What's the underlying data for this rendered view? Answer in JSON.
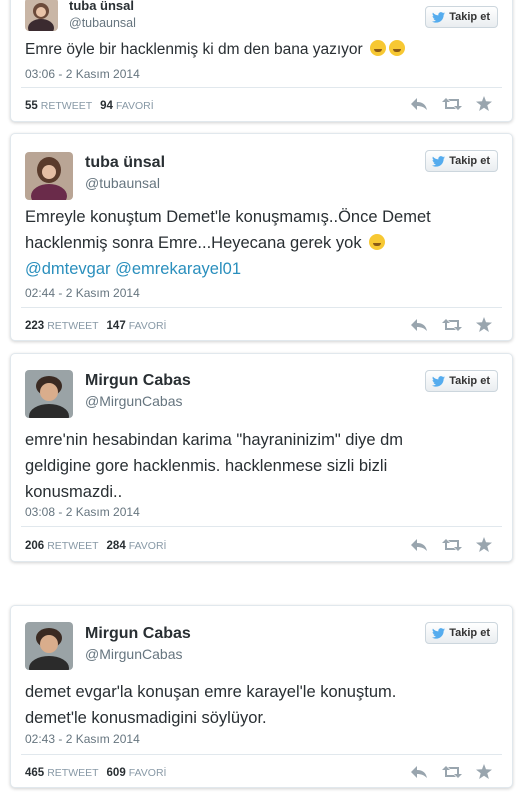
{
  "follow_label": "Takip et",
  "tweets": [
    {
      "name": "tuba ünsal",
      "handle": "@tubaunsal",
      "text": "Emre öyle bir hacklenmiş ki dm den bana yazıyor",
      "text_lines": [],
      "mentions": "",
      "date": "03:06 - 2 Kasım 2014",
      "retweets": "55",
      "retweet_label": "RETWEET",
      "favorites": "94",
      "favorite_label": "FAVORİ"
    },
    {
      "name": "tuba ünsal",
      "handle": "@tubaunsal",
      "text_line1": "Emreyle konuştum Demet'le konuşmamış..Önce Demet",
      "text_line2": "hacklenmiş sonra Emre...Heyecana gerek yok",
      "mentions": "@dmtevgar @emrekarayel01",
      "date": "02:44 - 2 Kasım 2014",
      "retweets": "223",
      "retweet_label": "RETWEET",
      "favorites": "147",
      "favorite_label": "FAVORİ"
    },
    {
      "name": "Mirgun Cabas",
      "handle": "@MirgunCabas",
      "text_line1": "emre'nin hesabindan karima \"hayraninizim\" diye dm",
      "text_line2": "geldigine gore hacklenmis. hacklenmese sizli bizli",
      "text_line3": "konusmazdi..",
      "date": "03:08 - 2 Kasım 2014",
      "retweets": "206",
      "retweet_label": "RETWEET",
      "favorites": "284",
      "favorite_label": "FAVORİ"
    },
    {
      "name": "Mirgun Cabas",
      "handle": "@MirgunCabas",
      "text_line1": "demet evgar'la konuşan emre karayel'le konuştum.",
      "text_line2": "demet'le konusmadigini söylüyor.",
      "date": "02:43 - 2 Kasım 2014",
      "retweets": "465",
      "retweet_label": "RETWEET",
      "favorites": "609",
      "favorite_label": "FAVORİ"
    }
  ]
}
